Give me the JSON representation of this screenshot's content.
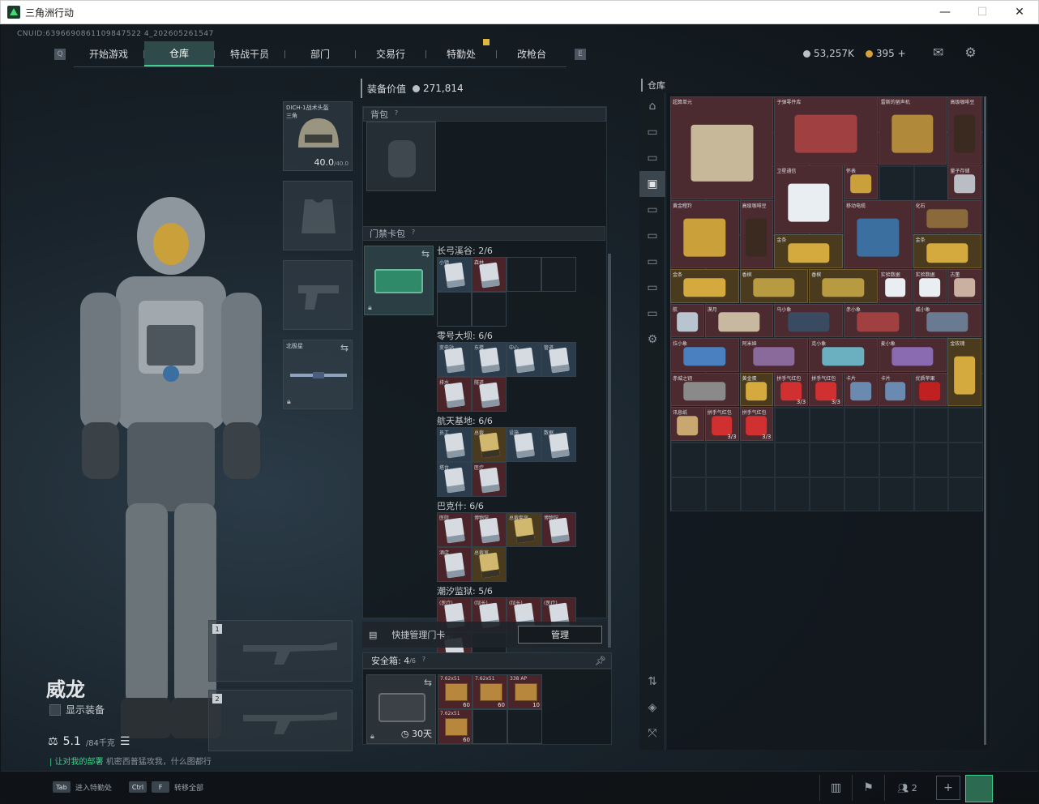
{
  "window": {
    "title": "三角洲行动",
    "minimize": "—",
    "maximize": "☐",
    "close": "✕"
  },
  "cnuid": "CNUID:6396690861109847522 4_202605261547",
  "nav": {
    "left_key": "Q",
    "right_key": "E",
    "tabs": [
      "开始游戏",
      "仓库",
      "特战干员",
      "部门",
      "交易行",
      "特勤处",
      "改枪台"
    ],
    "active": "仓库"
  },
  "currency": {
    "silver": "53,257K",
    "gold": "395",
    "add": "+"
  },
  "icons": {
    "mail": "mail-icon",
    "settings": "gear-icon"
  },
  "operator": {
    "name": "威龙",
    "show_equip_label": "显示装备",
    "weight": "5.1",
    "weight_max": "/84千克",
    "quote_prefix": "| 让对我的部署",
    "quote_body": "机密西普猛攻我，什么图都行"
  },
  "equip": {
    "helmet_name": "DICH-1战术头盔",
    "helmet_sub": "三角",
    "helmet_durability": "40.0",
    "helmet_max": "/40.0",
    "melee_name": "北极星"
  },
  "weapons": {
    "slot1": "1",
    "slot2": "2"
  },
  "inventory": {
    "equipment_value_label": "装备价值",
    "equipment_value": "271,814",
    "backpack_label": "背包",
    "keybag_label": "门禁卡包",
    "zones": [
      {
        "title": "长弓溪谷: 2/6",
        "cards": [
          "小镇",
          "森林"
        ],
        "slots": 6
      },
      {
        "title": "零号大坝: 6/6",
        "cards": [
          "变电站",
          "东楼",
          "中心",
          "管道",
          "排水",
          "隧道"
        ],
        "slots": 6
      },
      {
        "title": "航天基地: 6/6",
        "cards": [
          "员工",
          "总裁",
          "设施",
          "数据",
          "塔台",
          "医疗"
        ],
        "slots": 6
      },
      {
        "title": "巴克什: 6/6",
        "cards": [
          "医院",
          "博物馆",
          "总裁套房",
          "博物馆",
          "酒店",
          "总裁室"
        ],
        "slots": 6
      },
      {
        "title": "潮汐监狱: 5/6",
        "cards": [
          "(医疗)",
          "(狱长)",
          "(狱长)",
          "(医疗)",
          "(狱长)"
        ],
        "slots": 6
      }
    ],
    "quick_manage_label": "快捷管理门卡",
    "manage_button": "管理",
    "safe_label": "安全箱:",
    "safe_count": "4",
    "safe_max": "/6",
    "safe_days": "30天",
    "safe_items": [
      {
        "name": "7.62x51",
        "count": "60"
      },
      {
        "name": "7.62x51",
        "count": "60"
      },
      {
        "name": "338 AP",
        "count": "10"
      },
      {
        "name": "7.62x51",
        "count": "60"
      }
    ]
  },
  "warehouse": {
    "title": "仓库",
    "items": [
      {
        "name": "超算单元",
        "cls": ""
      },
      {
        "name": "子弹零件库",
        "cls": ""
      },
      {
        "name": "雷斯的留声机",
        "cls": ""
      },
      {
        "name": "高级咖啡豆",
        "cls": ""
      },
      {
        "name": "卫星通信",
        "cls": ""
      },
      {
        "name": "怀表",
        "cls": ""
      },
      {
        "name": "量子存储",
        "cls": ""
      },
      {
        "name": "黄金瞪羚",
        "cls": ""
      },
      {
        "name": "高级咖啡豆",
        "cls": ""
      },
      {
        "name": "金条",
        "cls": "gold"
      },
      {
        "name": "移动电缆",
        "cls": ""
      },
      {
        "name": "化石",
        "cls": ""
      },
      {
        "name": "金条",
        "cls": "gold"
      },
      {
        "name": "金条",
        "cls": "gold"
      },
      {
        "name": "香槟",
        "cls": "gold"
      },
      {
        "name": "香槟",
        "cls": "gold"
      },
      {
        "name": "实验数据",
        "cls": ""
      },
      {
        "name": "实验数据",
        "cls": ""
      },
      {
        "name": "古董",
        "cls": ""
      },
      {
        "name": "航",
        "cls": ""
      },
      {
        "name": "漠月",
        "cls": ""
      },
      {
        "name": "乌小象",
        "cls": ""
      },
      {
        "name": "赤小象",
        "cls": ""
      },
      {
        "name": "威小象",
        "cls": ""
      },
      {
        "name": "拉小象",
        "cls": ""
      },
      {
        "name": "阿米娅",
        "cls": ""
      },
      {
        "name": "克小象",
        "cls": ""
      },
      {
        "name": "麦小象",
        "cls": ""
      },
      {
        "name": "金玫瑰",
        "cls": "gold"
      },
      {
        "name": "赤城之钥",
        "cls": ""
      },
      {
        "name": "黄金蛋",
        "cls": "gold"
      },
      {
        "name": "拼手气红包",
        "cls": "",
        "count": "3/3"
      },
      {
        "name": "拼手气红包",
        "cls": "",
        "count": "3/3"
      },
      {
        "name": "卡片",
        "cls": ""
      },
      {
        "name": "卡片",
        "cls": ""
      },
      {
        "name": "优质苹果",
        "cls": ""
      },
      {
        "name": "讯息纸",
        "cls": ""
      },
      {
        "name": "拼手气红包",
        "cls": "",
        "count": "3/3"
      },
      {
        "name": "拼手气红包",
        "cls": "",
        "count": "3/3"
      }
    ]
  },
  "bottom": {
    "hint1_key": "Tab",
    "hint1": "进入特勤处",
    "hint2_key1": "Ctrl",
    "hint2_key2": "F",
    "hint2": "转移全部",
    "friends": "2",
    "add": "+"
  }
}
